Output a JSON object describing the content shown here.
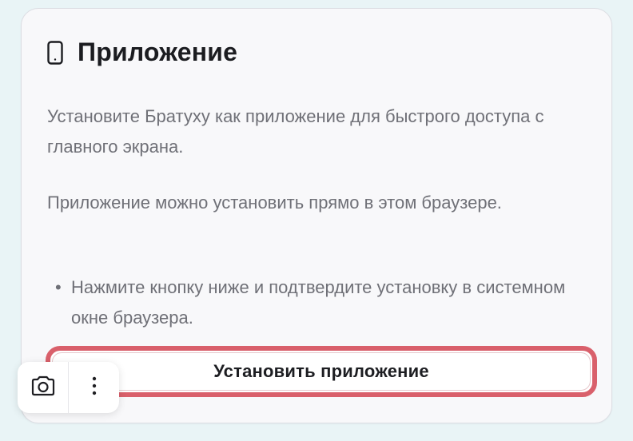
{
  "card": {
    "title": "Приложение",
    "title_icon": "phone-icon",
    "paragraph_1": "Установите Братуху как приложение для быстрого доступа с главного экрана.",
    "paragraph_2": "Приложение можно установить прямо в этом браузере.",
    "bullets": [
      "Нажмите кнопку ниже и подтвердите установку в системном окне браузера."
    ],
    "bullet_symbol": "•",
    "install_button_label": "Установить приложение"
  },
  "toolbar": {
    "items": [
      {
        "icon": "camera-icon"
      },
      {
        "icon": "more-vertical-icon"
      }
    ]
  },
  "colors": {
    "page_background": "#e9f4f6",
    "card_background": "#f8f8fa",
    "highlight_border": "#d9606b",
    "title_text": "#1b1c20",
    "body_text": "#6f7077"
  }
}
